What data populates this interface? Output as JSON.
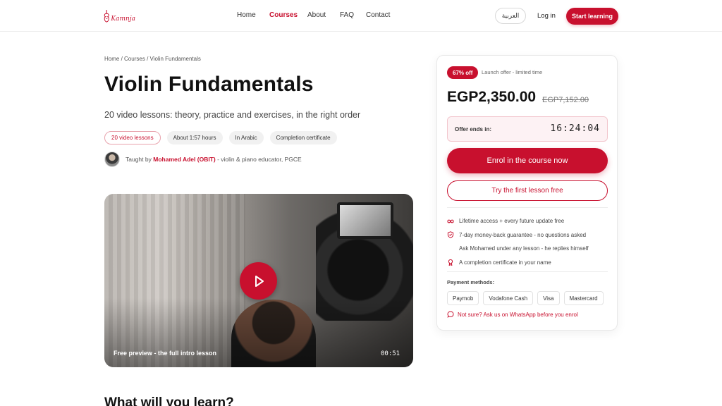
{
  "header": {
    "logo_text": "Kamnja",
    "nav": [
      {
        "label": "Home",
        "active": false
      },
      {
        "label": "Courses",
        "active": true
      },
      {
        "label": "About",
        "active": false
      },
      {
        "label": "FAQ",
        "active": false
      },
      {
        "label": "Contact",
        "active": false
      }
    ],
    "language_label": "العربية",
    "login_label": "Log in",
    "start_label": "Start learning"
  },
  "breadcrumb": [
    "Home",
    "Courses",
    "Violin Fundamentals"
  ],
  "course": {
    "title": "Violin Fundamentals",
    "subtitle": "20 video lessons: theory, practice and exercises, in the right order",
    "chips": [
      "20 video lessons",
      "About 1:57 hours",
      "In Arabic",
      "Completion certificate"
    ],
    "instructor_prefix": "Taught by",
    "instructor_name": "Mohamed Adel (OBIT)",
    "instructor_suffix": "- violin & piano educator, PGCE"
  },
  "video": {
    "caption": "Free preview - the full intro lesson",
    "duration": "00:51"
  },
  "section_heading": "What will you learn?",
  "purchase": {
    "discount_badge": "67% off",
    "offer_label": "Launch offer - limited time",
    "price": "EGP2,350.00",
    "old_price": "EGP7,152.00",
    "countdown_label": "Offer ends in:",
    "countdown_time": "16:24:04",
    "enrol_label": "Enrol in the course now",
    "trial_label": "Try the first lesson free",
    "features": [
      {
        "icon": "infinity-icon",
        "text": "Lifetime access + every future update free"
      },
      {
        "icon": "shield-icon",
        "text": "7-day money-back guarantee - no questions asked"
      },
      {
        "icon": "",
        "text": "Ask Mohamed under any lesson - he replies himself"
      },
      {
        "icon": "certificate-icon",
        "text": "A completion certificate in your name"
      }
    ],
    "payment_label": "Payment methods:",
    "payment_methods": [
      "Paymob",
      "Vodafone Cash",
      "Visa",
      "Mastercard"
    ],
    "whatsapp_text": "Not sure? Ask us on WhatsApp before you enrol"
  },
  "colors": {
    "accent": "#c8102e",
    "text": "#111111",
    "muted": "#555555"
  }
}
